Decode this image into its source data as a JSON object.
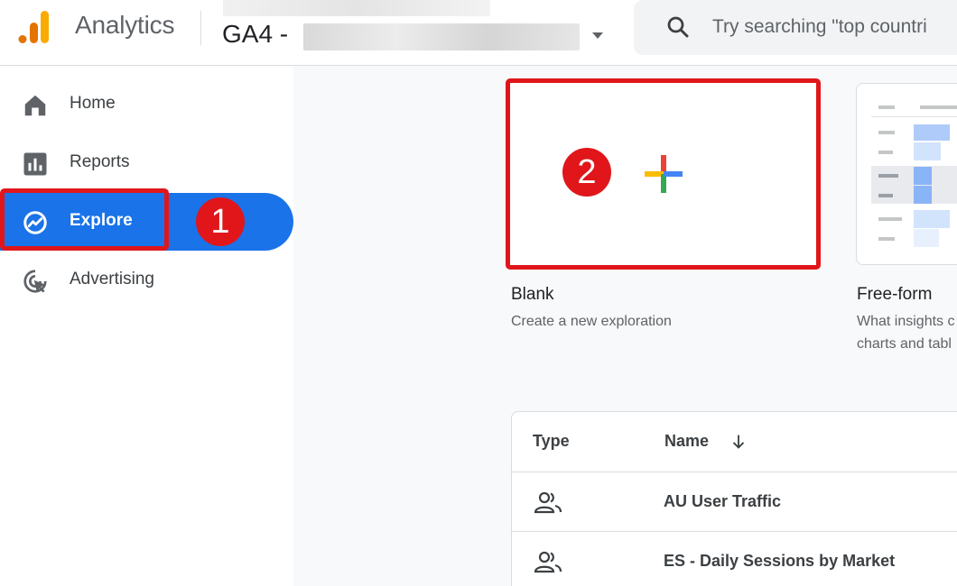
{
  "header": {
    "app_title": "Analytics",
    "property_prefix": "GA4 -",
    "search_placeholder": "Try searching \"top countri"
  },
  "sidebar": {
    "items": [
      {
        "label": "Home",
        "icon": "home-icon"
      },
      {
        "label": "Reports",
        "icon": "reports-icon"
      },
      {
        "label": "Explore",
        "icon": "explore-icon",
        "active": true
      },
      {
        "label": "Advertising",
        "icon": "advertising-icon"
      }
    ]
  },
  "templates": [
    {
      "title": "Blank",
      "description": "Create a new exploration"
    },
    {
      "title": "Free-form",
      "description_line1": "What insights c",
      "description_line2": "charts and tabl"
    }
  ],
  "table": {
    "columns": [
      "Type",
      "Name"
    ],
    "rows": [
      {
        "name": "AU User Traffic",
        "type_icon": "people-icon"
      },
      {
        "name": "ES - Daily Sessions by Market",
        "type_icon": "people-icon"
      }
    ]
  },
  "annotations": {
    "step1": "1",
    "step2": "2"
  },
  "colors": {
    "accent": "#1a73e8",
    "annotation_red": "#e0161b",
    "logo_orange": "#f9ab00",
    "logo_dark_orange": "#e37400"
  }
}
